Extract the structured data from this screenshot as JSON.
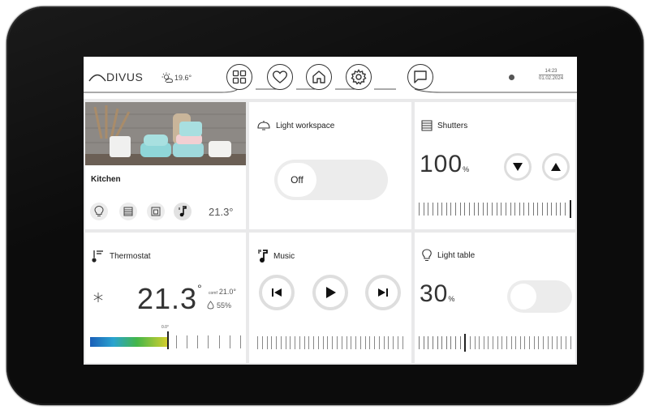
{
  "header": {
    "logo_text": "DIVUS",
    "temperature": "19.6°",
    "nav_items": [
      "grid-icon",
      "heart-icon",
      "home-icon",
      "gear-icon",
      "chat-icon"
    ],
    "time": "14:23",
    "date": "01.02.2024"
  },
  "kitchen": {
    "label": "Kitchen",
    "temperature": "21.3°",
    "icons": [
      "bulb-icon",
      "shutter-icon",
      "picture-shutter-icon",
      "music-icon"
    ]
  },
  "light_workspace": {
    "title": "Light workspace",
    "toggle_label": "Off"
  },
  "shutters": {
    "title": "Shutters",
    "value": "100",
    "unit": "%",
    "level": 100
  },
  "thermostat": {
    "title": "Thermostat",
    "temperature": "21.3",
    "degree": "°",
    "comf_label": "comf",
    "comf_value": "21.0°",
    "humidity": "55%",
    "scale_label": "0.0°"
  },
  "music": {
    "title": "Music"
  },
  "light_table": {
    "title": "Light table",
    "value": "30",
    "unit": "%",
    "level": 30
  },
  "colors": {
    "accent": "#222222",
    "screen_bg": "#e9e9ea",
    "device": "#0c0c0c"
  }
}
